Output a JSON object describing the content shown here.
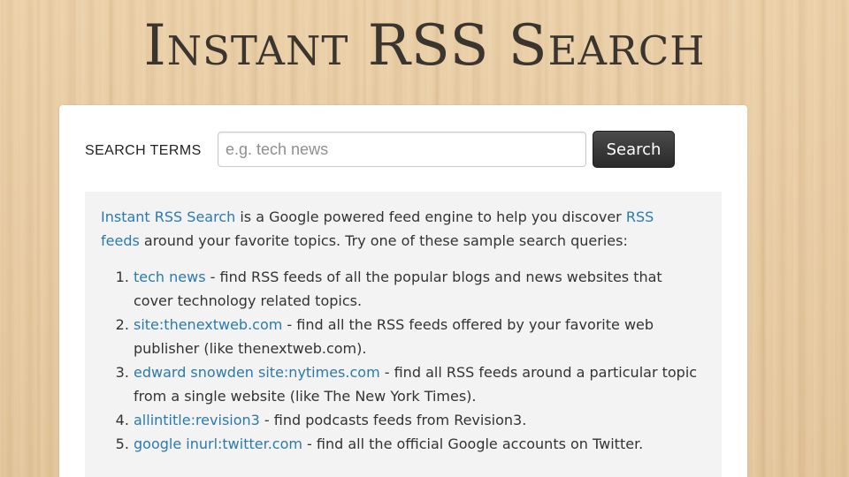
{
  "header": {
    "title": "Instant RSS Search"
  },
  "search": {
    "label": "SEARCH TERMS",
    "placeholder": "e.g. tech news",
    "value": "",
    "button_label": "Search"
  },
  "intro": {
    "app_link": "Instant RSS Search",
    "text_1": " is a Google powered feed engine to help you discover ",
    "rss_link": "RSS feeds",
    "text_2": " around your favorite topics. Try one of these sample search queries:"
  },
  "examples": [
    {
      "query": "tech news",
      "description": " - find RSS feeds of all the popular blogs and news websites that cover technology related topics."
    },
    {
      "query": "site:thenextweb.com",
      "description": " - find all the RSS feeds offered by your favorite web publisher (like thenextweb.com)."
    },
    {
      "query": "edward snowden site:nytimes.com",
      "description": " - find all RSS feeds around a particular topic from a single website (like The New York Times)."
    },
    {
      "query": "allintitle:revision3",
      "description": " - find podcasts feeds from Revision3."
    },
    {
      "query": "google inurl:twitter.com",
      "description": " - find all the official Google accounts on Twitter."
    }
  ],
  "colors": {
    "link": "#2a7ab0",
    "title": "#3a352f",
    "button": "#333333",
    "background": "#e6caa0"
  }
}
